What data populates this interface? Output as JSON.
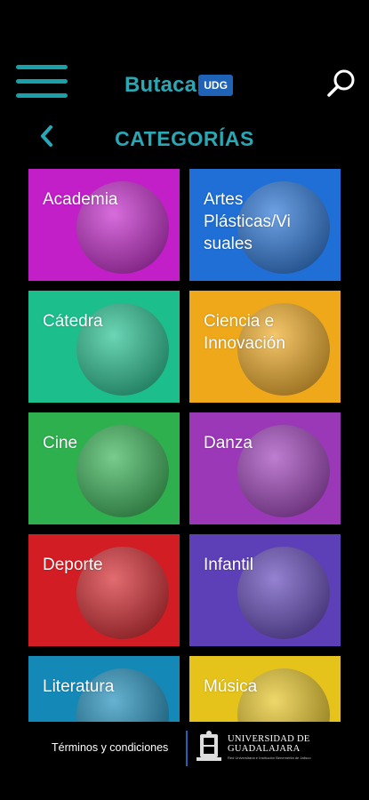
{
  "header": {
    "logo_text": "Butaca",
    "logo_badge": "UDG",
    "menu_icon": "hamburger-menu-icon",
    "search_icon": "search-icon"
  },
  "nav": {
    "back_icon": "chevron-left-icon",
    "title": "CATEGORÍAS"
  },
  "categories": [
    {
      "label": "Academia",
      "color": "#c21fc9"
    },
    {
      "label": "Artes Plásticas/Visuales",
      "label_lines": [
        "Artes",
        "Plásticas/Vi",
        "suales"
      ],
      "color": "#1f6fd6"
    },
    {
      "label": "Cátedra",
      "color": "#1cbf8c"
    },
    {
      "label": "Ciencia e Innovación",
      "label_lines": [
        "Ciencia e",
        "Innovación"
      ],
      "color": "#f0a81b"
    },
    {
      "label": "Cine",
      "color": "#2fb04f"
    },
    {
      "label": "Danza",
      "color": "#9b38b8"
    },
    {
      "label": "Deporte",
      "color": "#d31d24"
    },
    {
      "label": "Infantil",
      "color": "#5d3fb8"
    },
    {
      "label": "Literatura",
      "color": "#1489b8"
    },
    {
      "label": "Música",
      "color": "#e6c31b"
    }
  ],
  "footer": {
    "terms": "Términos y condiciones",
    "udg_line1": "UNIVERSIDAD DE",
    "udg_line2": "GUADALAJARA",
    "udg_line3": "Red Universitaria e Institución Benemérita de Jalisco",
    "accent_color": "#1f63b6"
  },
  "colors": {
    "background": "#000000",
    "accent": "#2aa7b5"
  }
}
